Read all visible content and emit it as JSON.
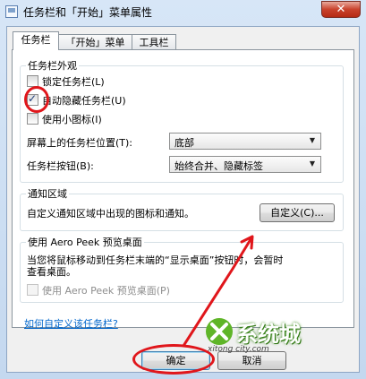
{
  "window": {
    "title": "任务栏和「开始」菜单属性",
    "close_glyph": "✕"
  },
  "tabs": [
    {
      "label": "任务栏"
    },
    {
      "label": "「开始」菜单"
    },
    {
      "label": "工具栏"
    }
  ],
  "appearance": {
    "title": "任务栏外观",
    "checkboxes": [
      {
        "label": "锁定任务栏(L)",
        "checked": false
      },
      {
        "label": "自动隐藏任务栏(U)",
        "checked": true
      },
      {
        "label": "使用小图标(I)",
        "checked": false
      }
    ],
    "position_label": "屏幕上的任务栏位置(T):",
    "position_value": "底部",
    "buttons_label": "任务栏按钮(B):",
    "buttons_value": "始终合并、隐藏标签"
  },
  "notification": {
    "title": "通知区域",
    "description": "自定义通知区域中出现的图标和通知。",
    "customize_button": "自定义(C)..."
  },
  "aero_peek": {
    "title": "使用 Aero Peek 预览桌面",
    "description_line1": "当您将鼠标移动到任务栏末端的“显示桌面”按钮时，会暂时",
    "description_line2": "查看桌面。",
    "checkbox_label": "使用 Aero Peek 预览桌面(P)",
    "checkbox_checked": false
  },
  "help_link": "如何自定义该任务栏?",
  "footer": {
    "ok": "确定",
    "cancel": "取消"
  },
  "watermark": {
    "text": "系统城",
    "sub": "xitong city.com"
  },
  "colors": {
    "annotation_red": "#e0161b",
    "link_blue": "#0066cc"
  }
}
